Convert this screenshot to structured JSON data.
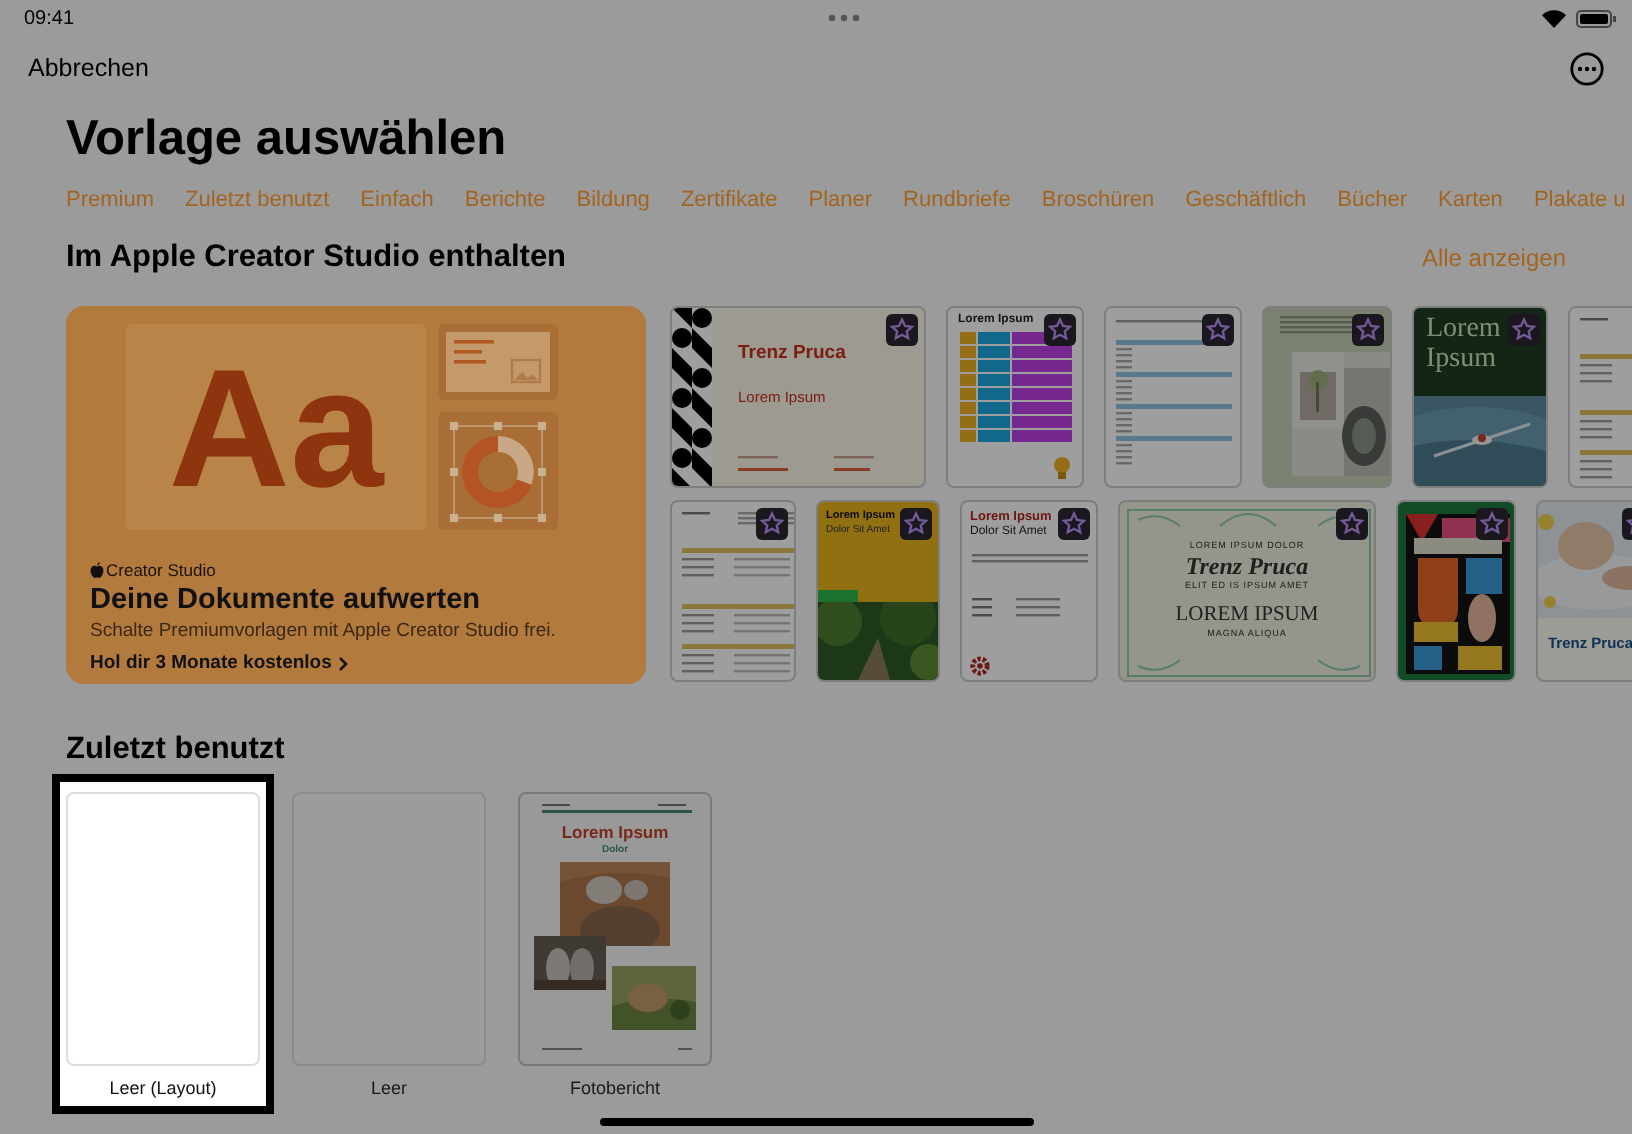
{
  "status_bar": {
    "time": "09:41"
  },
  "toolbar": {
    "cancel_button": "Abbrechen"
  },
  "title": "Vorlage auswählen",
  "categories": [
    "Premium",
    "Zuletzt benutzt",
    "Einfach",
    "Berichte",
    "Bildung",
    "Zertifikate",
    "Planer",
    "Rundbriefe",
    "Broschüren",
    "Geschäftlich",
    "Bücher",
    "Karten",
    "Plakate u"
  ],
  "featured": {
    "title": "Im Apple Creator Studio enthalten",
    "see_all": "Alle anzeigen",
    "promo": {
      "artwork_text": "Aa",
      "brand": "Creator Studio",
      "headline": "Deine Dokumente aufwerten",
      "text": "Schalte Premiumvorlagen mit Apple Creator Studio frei.",
      "link": "Hol dir 3 Monate kostenlos"
    },
    "templates": [
      [
        {
          "kind": "pattern-report",
          "badge": true,
          "texts": [
            "Trenz Pruca",
            "Lorem Ipsum"
          ]
        },
        {
          "kind": "table",
          "badge": true,
          "texts": [
            "Lorem Ipsum"
          ]
        },
        {
          "kind": "schedule",
          "badge": true
        },
        {
          "kind": "photo-collage",
          "badge": true
        },
        {
          "kind": "magazine",
          "badge": true,
          "texts": [
            "Lorem Ipsum"
          ]
        },
        {
          "kind": "resume",
          "badge": false
        }
      ],
      [
        {
          "kind": "resume",
          "badge": true
        },
        {
          "kind": "flyer",
          "badge": true,
          "texts": [
            "Lorem Ipsum",
            "Dolor Sit Amet"
          ]
        },
        {
          "kind": "letter",
          "badge": true,
          "texts": [
            "Lorem Ipsum",
            "Dolor Sit Amet"
          ]
        },
        {
          "kind": "certificate",
          "badge": true,
          "texts": [
            "LOREM IPSUM DOLOR",
            "Trenz Pruca",
            "ELIT ED IS IPSUM AMET",
            "LOREM IPSUM",
            "MAGNA ALIQUA"
          ]
        },
        {
          "kind": "poster",
          "badge": true
        },
        {
          "kind": "baby",
          "badge": true,
          "texts": [
            "Trenz Pruca"
          ]
        }
      ]
    ]
  },
  "recent": {
    "title": "Zuletzt benutzt",
    "items": [
      {
        "name": "Leer (Layout)",
        "kind": "blank",
        "selected": true
      },
      {
        "name": "Leer",
        "kind": "blank",
        "selected": false
      },
      {
        "name": "Fotobericht",
        "kind": "photo-report",
        "selected": false,
        "texts": [
          "Lorem Ipsum",
          "Dolor"
        ]
      }
    ]
  }
}
